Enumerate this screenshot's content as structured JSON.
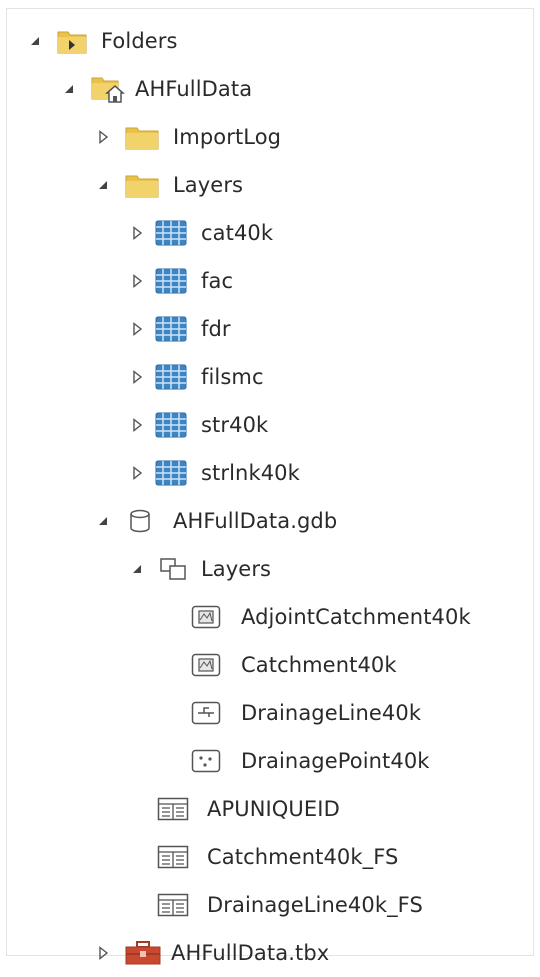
{
  "tree": {
    "folders": "Folders",
    "ahfulldata": "AHFullData",
    "importlog": "ImportLog",
    "layers_folder": "Layers",
    "rasters": [
      "cat40k",
      "fac",
      "fdr",
      "filsmc",
      "str40k",
      "strlnk40k"
    ],
    "gdb": "AHFullData.gdb",
    "gdb_layers": "Layers",
    "feature_classes": [
      "AdjointCatchment40k",
      "Catchment40k",
      "DrainageLine40k",
      "DrainagePoint40k"
    ],
    "tables": [
      "APUNIQUEID",
      "Catchment40k_FS",
      "DrainageLine40k_FS"
    ],
    "toolbox": "AHFullData.tbx"
  },
  "colors": {
    "folder": "#e8c24a",
    "raster": "#3d86c6",
    "toolbox": "#c8492f",
    "text": "#2a2a2a",
    "arrow": "#444444"
  }
}
